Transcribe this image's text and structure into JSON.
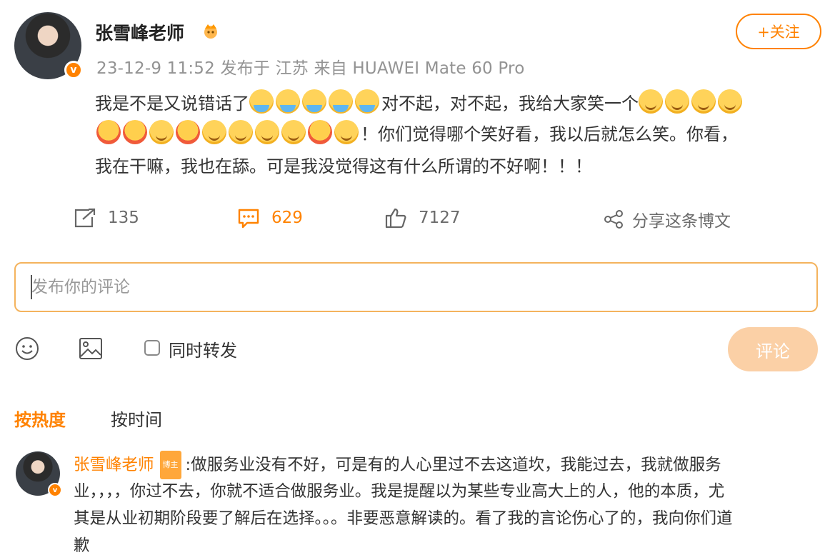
{
  "post": {
    "author": "张雪峰老师",
    "meta": "23-12-9 11:52 发布于 江苏 来自 HUAWEI Mate 60 Pro",
    "follow_label": "+关注",
    "line1_a": "我是不是又说错话了",
    "line1_b": "对不起，对不起，我给大家笑一个",
    "line2": "！你们觉得哪个笑好看，我以后就怎么笑。你看，",
    "line3": "我在干嘛，我也在舔。可是我没觉得这有什么所谓的不好啊！！！"
  },
  "stats": {
    "repost": "135",
    "comments": "629",
    "likes": "7127",
    "share_label": "分享这条博文"
  },
  "composer": {
    "placeholder": "发布你的评论",
    "repost_label": "同时转发",
    "submit_label": "评论"
  },
  "sort": {
    "hot": "按热度",
    "time": "按时间"
  },
  "comment": {
    "author": "张雪峰老师",
    "badge": "博主",
    "line1": ":做服务业没有不好，可是有的人心里过不去这道坎，我能过去，我就做服务",
    "line2": "业，，，，你过不去，你就不适合做服务业。我是提醒以为某些专业高大上的人，他的本质，尤",
    "line3": "其是从业初期阶段要了解后在选择。。。非要恶意解读的。看了我的言论伤心了的，我向你们道",
    "line4": "歉"
  },
  "colors": {
    "accent": "#ff8200",
    "meta_gray": "#939393",
    "submit_disabled": "#fbd0a6"
  }
}
